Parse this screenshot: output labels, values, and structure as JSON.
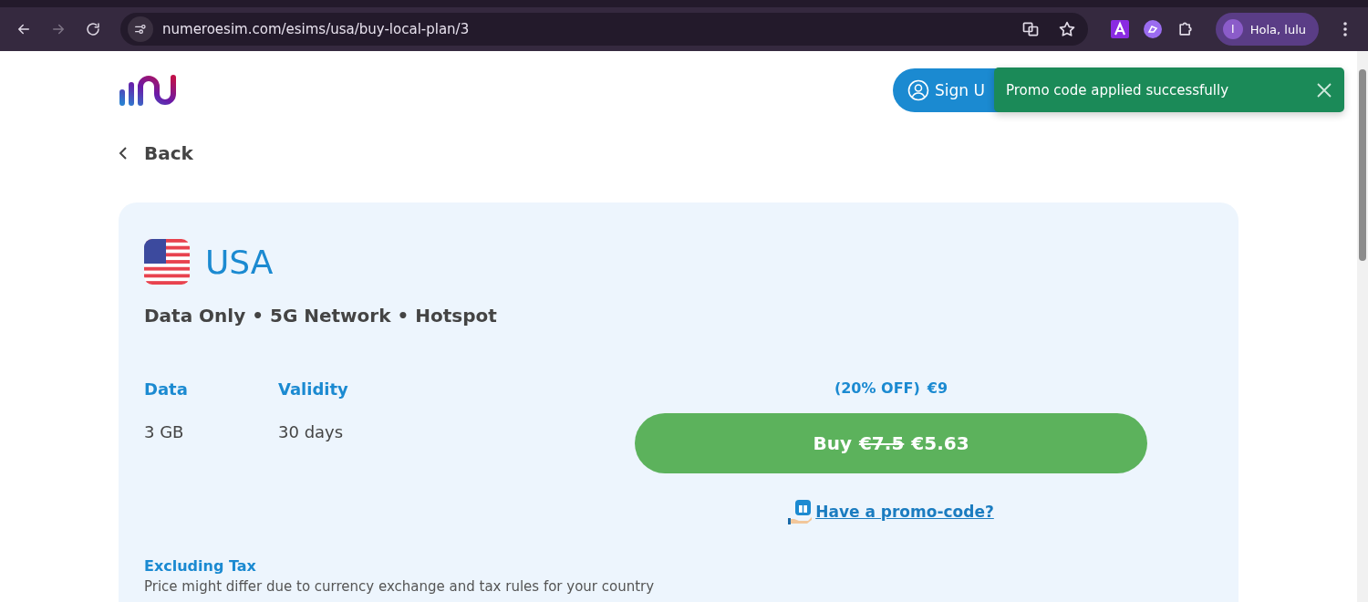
{
  "browser": {
    "url": "numeroesim.com/esims/usa/buy-local-plan/3",
    "profile": {
      "initial": "I",
      "name": "Hola, lulu"
    }
  },
  "header": {
    "sign_up": "Sign U"
  },
  "toast": {
    "message": "Promo code applied successfully"
  },
  "back": "Back",
  "plan": {
    "country": "USA",
    "features": "Data Only • 5G Network • Hotspot",
    "specs": [
      {
        "label": "Data",
        "value": "3 GB"
      },
      {
        "label": "Validity",
        "value": "30 days"
      }
    ],
    "discount": "(20% OFF)",
    "list_price": "€9",
    "buy": {
      "label": "Buy",
      "old_price": "€7.5",
      "price": "€5.63"
    },
    "promo_link": "Have a promo-code?",
    "tax_title": "Excluding Tax",
    "tax_note": "Price might differ due to currency exchange and tax rules for your country"
  }
}
